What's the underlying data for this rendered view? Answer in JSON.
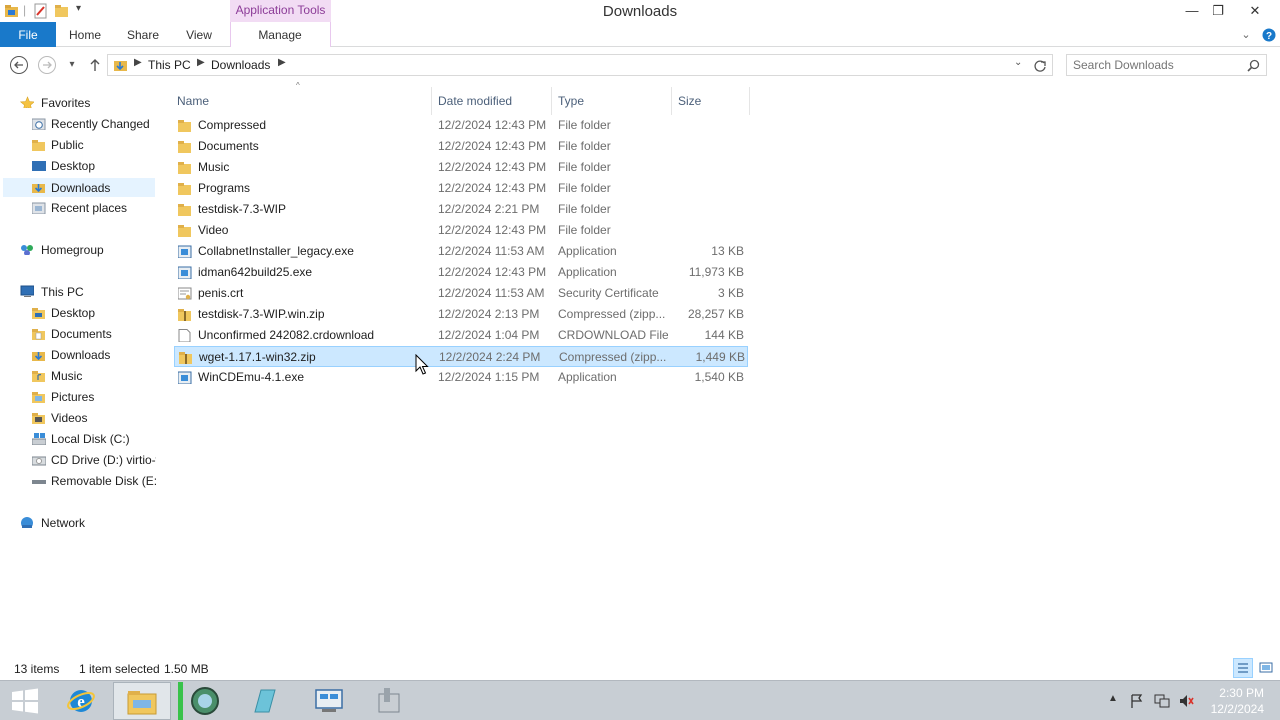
{
  "window": {
    "title": "Downloads",
    "context_tab_header": "Application Tools",
    "minimize_glyph": "—",
    "restore_glyph": "❐",
    "close_glyph": "✕"
  },
  "ribbon": {
    "tabs": [
      "File",
      "Home",
      "Share",
      "View",
      "Manage"
    ]
  },
  "address": {
    "crumbs": [
      "This PC",
      "Downloads"
    ],
    "search_placeholder": "Search Downloads"
  },
  "nav": {
    "favorites": {
      "label": "Favorites",
      "items": [
        "Recently Changed",
        "Public",
        "Desktop",
        "Downloads",
        "Recent places"
      ]
    },
    "homegroup": "Homegroup",
    "thispc": {
      "label": "This PC",
      "items": [
        "Desktop",
        "Documents",
        "Downloads",
        "Music",
        "Pictures",
        "Videos",
        "Local Disk (C:)",
        "CD Drive (D:) virtio-win",
        "Removable Disk (E:)"
      ]
    },
    "network": "Network"
  },
  "columns": {
    "name": "Name",
    "date": "Date modified",
    "type": "Type",
    "size": "Size"
  },
  "files": [
    {
      "name": "Compressed",
      "date": "12/2/2024 12:43 PM",
      "type": "File folder",
      "size": "",
      "icon": "folder-icon"
    },
    {
      "name": "Documents",
      "date": "12/2/2024 12:43 PM",
      "type": "File folder",
      "size": "",
      "icon": "folder-icon"
    },
    {
      "name": "Music",
      "date": "12/2/2024 12:43 PM",
      "type": "File folder",
      "size": "",
      "icon": "folder-icon"
    },
    {
      "name": "Programs",
      "date": "12/2/2024 12:43 PM",
      "type": "File folder",
      "size": "",
      "icon": "folder-icon"
    },
    {
      "name": "testdisk-7.3-WIP",
      "date": "12/2/2024 2:21 PM",
      "type": "File folder",
      "size": "",
      "icon": "folder-icon"
    },
    {
      "name": "Video",
      "date": "12/2/2024 12:43 PM",
      "type": "File folder",
      "size": "",
      "icon": "folder-icon"
    },
    {
      "name": "CollabnetInstaller_legacy.exe",
      "date": "12/2/2024 11:53 AM",
      "type": "Application",
      "size": "13 KB",
      "icon": "exe-icon"
    },
    {
      "name": "idman642build25.exe",
      "date": "12/2/2024 12:43 PM",
      "type": "Application",
      "size": "11,973 KB",
      "icon": "exe-icon"
    },
    {
      "name": "penis.crt",
      "date": "12/2/2024 11:53 AM",
      "type": "Security Certificate",
      "size": "3 KB",
      "icon": "certificate-icon"
    },
    {
      "name": "testdisk-7.3-WIP.win.zip",
      "date": "12/2/2024 2:13 PM",
      "type": "Compressed (zipp...",
      "size": "28,257 KB",
      "icon": "zip-folder-icon"
    },
    {
      "name": "Unconfirmed 242082.crdownload",
      "date": "12/2/2024 1:04 PM",
      "type": "CRDOWNLOAD File",
      "size": "144 KB",
      "icon": "file-icon"
    },
    {
      "name": "wget-1.17.1-win32.zip",
      "date": "12/2/2024 2:24 PM",
      "type": "Compressed (zipp...",
      "size": "1,449 KB",
      "icon": "zip-folder-icon"
    },
    {
      "name": "WinCDEmu-4.1.exe",
      "date": "12/2/2024 1:15 PM",
      "type": "Application",
      "size": "1,540 KB",
      "icon": "exe-icon"
    }
  ],
  "selected_file": "wget-1.17.1-win32.zip",
  "status": {
    "items": "13 items",
    "selection": "1 item selected",
    "size": "1.50 MB"
  },
  "taskbar": {
    "time": "2:30 PM",
    "date": "12/2/2024"
  },
  "colors": {
    "accent": "#1979ca",
    "selection": "#cce8ff",
    "context_tab": "#f2dcf4"
  }
}
